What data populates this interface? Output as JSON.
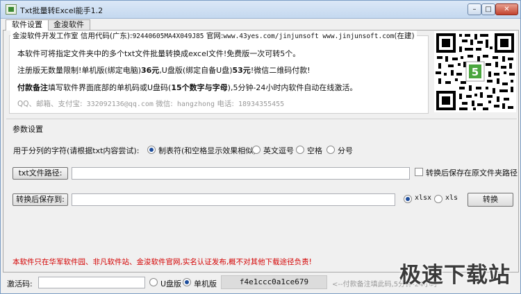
{
  "window": {
    "title": "Txt批量转Excel能手1.2",
    "controls": {
      "minimize": "–",
      "maximize": "□",
      "close": "✕"
    }
  },
  "tabs": [
    {
      "label": "软件设置",
      "active": true
    },
    {
      "label": "金浚软件",
      "active": false
    }
  ],
  "info": {
    "header_prefix": "金浚软件开发工作室 信用代码(广东):",
    "header_code": "92440605MA4X049J85",
    "header_site_label": " 官网:",
    "header_sites": "www.43yes.com/jinjunsoft  www.jinjunsoft.com",
    "header_suffix": "(在建)",
    "line1": "本软件可将指定文件夹中的多个txt文件批量转换成excel文件!免费版一次可转5个。",
    "line2_a": "注册版无数量限制!单机版(绑定电脑)",
    "line2_price1": "36元",
    "line2_b": ",U盘版(绑定自备U盘)",
    "line2_price2": "53元",
    "line2_c": "!微信二维码付款!",
    "line3_title": "付款备注",
    "line3_a": "填写软件界面底部的单机码或U盘码(",
    "line3_bold": "15个数字与字母",
    "line3_b": "),5分钟-24小时内软件自动在线激活。",
    "contact_label": "QQ、邮箱、支付宝:",
    "contact_qq": " 332092136@qq.com",
    "wechat_label": "   微信:",
    "wechat": " hangzhong",
    "phone_label": "   电话:",
    "phone": " 18934355455"
  },
  "params": {
    "legend": "参数设置",
    "separator_label": "用于分列的字符(请根据txt内容尝试):",
    "separator_options": [
      {
        "label": "制表符(和空格显示效果相似)",
        "checked": true
      },
      {
        "label": "英文逗号",
        "checked": false
      },
      {
        "label": "空格",
        "checked": false
      },
      {
        "label": "分号",
        "checked": false
      }
    ],
    "txt_path_button": "txt文件路径:",
    "txt_path_value": "",
    "same_folder_label": "转换后保存在原文件夹路径",
    "same_folder_checked": false,
    "save_to_button": "转换后保存到:",
    "save_to_value": "",
    "formats": [
      {
        "label": "xlsx",
        "checked": true
      },
      {
        "label": "xls",
        "checked": false
      }
    ],
    "convert_button": "转换"
  },
  "warning": "本软件只在华军软件园、非凡软件站、金浚软件官网,实名认证发布,概不对其他下载途径负责!",
  "bottom": {
    "activation_label": "激活码:",
    "activation_value": "",
    "usb_label": "U盘版",
    "usb_checked": false,
    "standalone_label": "单机版",
    "standalone_checked": true,
    "machine_code": "f4e1ccc0a1ce679",
    "hint": "<--付款备注填此码,5分钟-24小时内软件自动在线激活"
  },
  "watermark": "极速下载站",
  "colors": {
    "title_bar": "#c4d8ef",
    "warning_text": "#d40000",
    "radio_dot": "#1f4e9c"
  },
  "icons": [
    "app-icon",
    "qr-code",
    "minimize-icon",
    "maximize-icon",
    "close-icon"
  ]
}
